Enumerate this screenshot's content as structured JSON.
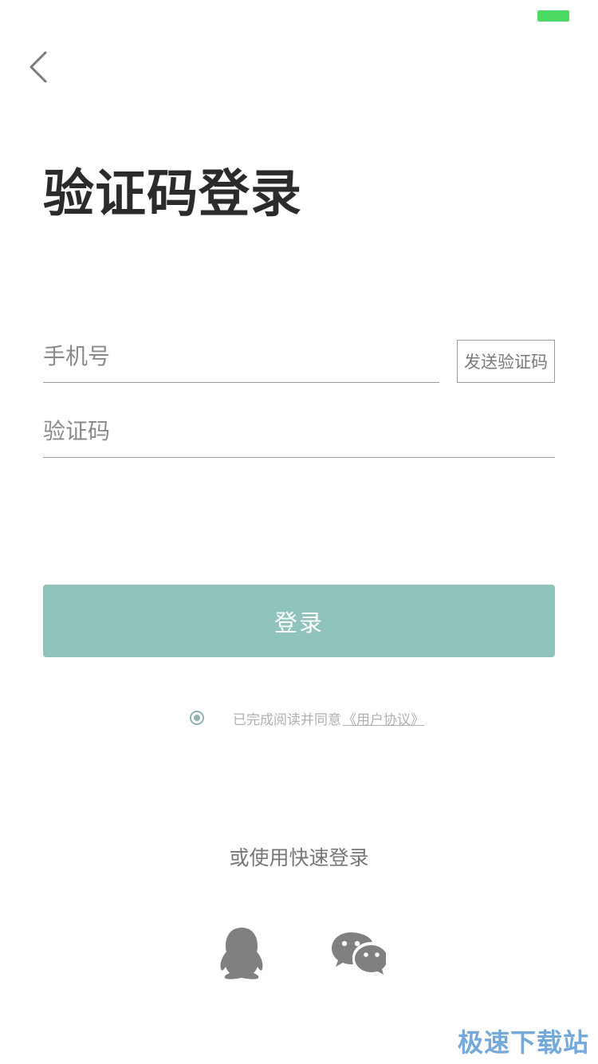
{
  "status_bar": {
    "battery_color": "#4cd964"
  },
  "nav": {
    "back_icon": "chevron-left-icon"
  },
  "page": {
    "title": "验证码登录"
  },
  "form": {
    "phone_placeholder": "手机号",
    "code_placeholder": "验证码",
    "send_code_label": "发送验证码",
    "login_label": "登录",
    "login_button_color": "#8fc3bb"
  },
  "agreement": {
    "checked": true,
    "text": "已完成阅读并同意",
    "link_label": "《用户协议》",
    "radio_color": "#8fb3b0"
  },
  "quick_login": {
    "title": "或使用快速登录",
    "providers": [
      {
        "icon": "qq-icon"
      },
      {
        "icon": "wechat-icon"
      }
    ],
    "icon_color": "#808080"
  },
  "watermark": {
    "text": "极速下载站"
  }
}
